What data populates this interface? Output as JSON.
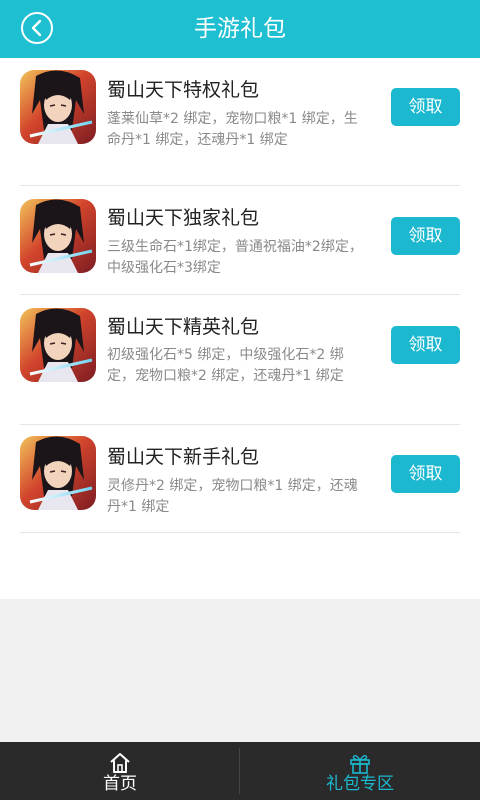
{
  "header": {
    "title": "手游礼包",
    "back_icon": "back-circle-icon"
  },
  "gifts": [
    {
      "title": "蜀山天下特权礼包",
      "desc": "蓬莱仙草*2 绑定，宠物口粮*1 绑定，生命丹*1 绑定，还魂丹*1 绑定",
      "button": "领取"
    },
    {
      "title": "蜀山天下独家礼包",
      "desc": "三级生命石*1绑定，普通祝福油*2绑定，中级强化石*3绑定",
      "button": "领取"
    },
    {
      "title": "蜀山天下精英礼包",
      "desc": "初级强化石*5 绑定，中级强化石*2 绑定，宠物口粮*2 绑定，还魂丹*1 绑定",
      "button": "领取"
    },
    {
      "title": "蜀山天下新手礼包",
      "desc": "灵修丹*2 绑定，宠物口粮*1 绑定，还魂丹*1 绑定",
      "button": "领取"
    }
  ],
  "tabbar": {
    "home": {
      "label": "首页",
      "icon": "home-icon"
    },
    "gifts": {
      "label": "礼包专区",
      "icon": "gift-icon"
    }
  },
  "colors": {
    "accent": "#1dbfd1",
    "button": "#1cb8cf",
    "tabbar_bg": "#2a2a2a",
    "title_text": "#222222",
    "desc_text": "#8a8a8a"
  }
}
